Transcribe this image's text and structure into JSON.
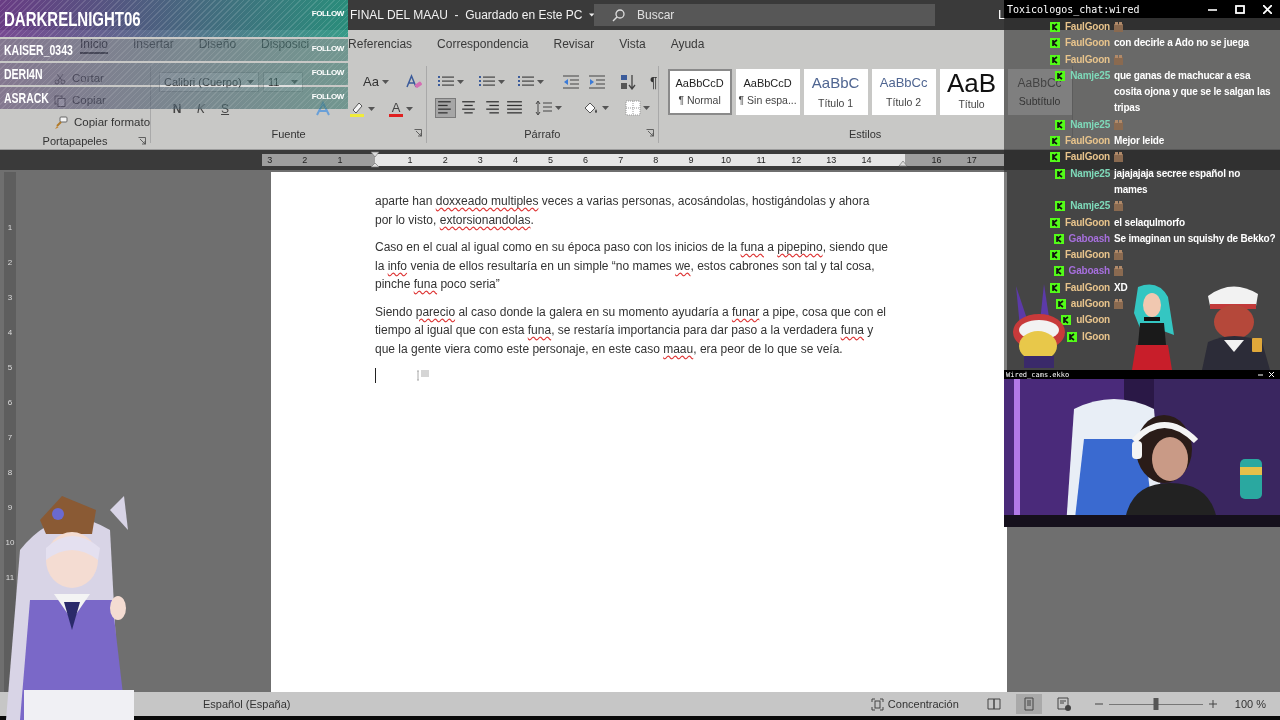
{
  "follow_overlay": {
    "rows": [
      {
        "name": "DARKRELNIGHT06",
        "action": "FOLLOW",
        "kind": "featured"
      },
      {
        "name": "KAISER_0343",
        "action": "FOLLOW",
        "kind": "normal"
      },
      {
        "name": "DERI4N",
        "action": "FOLLOW",
        "kind": "normal"
      },
      {
        "name": "ASRACK",
        "action": "FOLLOW",
        "kind": "normal"
      }
    ]
  },
  "title_bar": {
    "title": "FINAL DEL MAAU  -  Guardado en Este PC",
    "search": {
      "placeholder": "Buscar"
    },
    "user_initial": "L"
  },
  "ribbon_tabs": [
    {
      "label": "Inicio",
      "selected": true
    },
    {
      "label": "Insertar",
      "selected": false
    },
    {
      "label": "Diseño",
      "selected": false
    },
    {
      "label": "Disposici",
      "selected": false
    },
    {
      "label": "Referencias",
      "selected": false
    },
    {
      "label": "Correspondencia",
      "selected": false
    },
    {
      "label": "Revisar",
      "selected": false
    },
    {
      "label": "Vista",
      "selected": false
    },
    {
      "label": "Ayuda",
      "selected": false
    }
  ],
  "clipboard": {
    "label": "Portapapeles",
    "commands": [
      {
        "label": "Cortar",
        "kind": "cut"
      },
      {
        "label": "Copiar",
        "kind": "copy"
      },
      {
        "label": "Copiar formato",
        "kind": "format-painter"
      }
    ]
  },
  "font": {
    "label": "Fuente",
    "font_name": "Calibri (Cuerpo)",
    "font_size": "11",
    "change_case": "Aa",
    "font_color": "A",
    "format_buttons": [
      {
        "label": "N",
        "kind": "bold"
      },
      {
        "label": "K",
        "kind": "italic"
      },
      {
        "label": "S",
        "kind": "underline"
      }
    ]
  },
  "paragraph": {
    "label": "Párrafo",
    "show_marks": "¶",
    "align_buttons": [
      {
        "kind": "left",
        "selected": true
      },
      {
        "kind": "center",
        "selected": false
      },
      {
        "kind": "right",
        "selected": false
      },
      {
        "kind": "justify",
        "selected": false
      }
    ]
  },
  "styles": {
    "label": "Estilos",
    "items": [
      {
        "preview": "AaBbCcD",
        "name": "¶ Normal",
        "kind": "body",
        "selected": true
      },
      {
        "preview": "AaBbCcD",
        "name": "¶ Sin espa...",
        "kind": "body",
        "selected": false
      },
      {
        "preview": "AaBbC",
        "name": "Título 1",
        "kind": "heading1",
        "selected": false
      },
      {
        "preview": "AaBbCc",
        "name": "Título 2",
        "kind": "heading2",
        "selected": false
      },
      {
        "preview": "AaB",
        "name": "Título",
        "kind": "title",
        "selected": false
      },
      {
        "preview": "AaBbCc",
        "name": "Subtítulo",
        "kind": "subtitle",
        "selected": false
      }
    ]
  },
  "ruler": {
    "left_marks": [
      "3",
      "2",
      "1"
    ],
    "right_marks": [
      "1",
      "2",
      "3",
      "4",
      "5",
      "6",
      "7",
      "8",
      "9",
      "10",
      "11",
      "12",
      "13",
      "14",
      "16",
      "17"
    ],
    "vertical_marks": [
      "1",
      "2",
      "3",
      "4",
      "5",
      "6",
      "7",
      "8",
      "9",
      "10",
      "11"
    ]
  },
  "document": {
    "paragraphs": [
      {
        "lines": [
          [
            {
              "text": "aparte han ",
              "misspelled": false
            },
            {
              "text": "doxxeado multiples",
              "misspelled": true
            },
            {
              "text": " veces a varias personas, acosándolas, hostigándolas y ahora",
              "misspelled": false
            }
          ],
          [
            {
              "text": "por lo visto, ",
              "misspelled": false
            },
            {
              "text": "extorsionandolas",
              "misspelled": true
            },
            {
              "text": ".",
              "misspelled": false
            }
          ]
        ]
      },
      {
        "lines": [
          [
            {
              "text": "Caso en el cual al igual como en su época paso con los inicios de la ",
              "misspelled": false
            },
            {
              "text": "funa",
              "misspelled": true
            },
            {
              "text": " a ",
              "misspelled": false
            },
            {
              "text": "pipepino",
              "misspelled": true
            },
            {
              "text": ", siendo que",
              "misspelled": false
            }
          ],
          [
            {
              "text": "la ",
              "misspelled": false
            },
            {
              "text": "info",
              "misspelled": true
            },
            {
              "text": " venia de ellos resultaría en un simple “no mames ",
              "misspelled": false
            },
            {
              "text": "we",
              "misspelled": true
            },
            {
              "text": ", estos cabrones son tal y tal cosa,",
              "misspelled": false
            }
          ],
          [
            {
              "text": "pinche ",
              "misspelled": false
            },
            {
              "text": "funa",
              "misspelled": true
            },
            {
              "text": " poco seria”",
              "misspelled": false
            }
          ]
        ]
      },
      {
        "lines": [
          [
            {
              "text": "Siendo ",
              "misspelled": false
            },
            {
              "text": "parecio",
              "misspelled": true
            },
            {
              "text": " al caso donde la galera en su momento ayudaría a ",
              "misspelled": false
            },
            {
              "text": "funar",
              "misspelled": true
            },
            {
              "text": " a pipe, cosa que con el",
              "misspelled": false
            }
          ],
          [
            {
              "text": "tiempo al igual que con esta ",
              "misspelled": false
            },
            {
              "text": "funa",
              "misspelled": true
            },
            {
              "text": ", se restaría importancia para dar paso a la verdadera ",
              "misspelled": false
            },
            {
              "text": "funa",
              "misspelled": true
            },
            {
              "text": " y",
              "misspelled": false
            }
          ],
          [
            {
              "text": "que la gente viera como este personaje, en este caso ",
              "misspelled": false
            },
            {
              "text": "maau",
              "misspelled": true
            },
            {
              "text": ", era peor de lo que se veía.",
              "misspelled": false
            }
          ]
        ]
      }
    ]
  },
  "status_bar": {
    "language": "Español (España)",
    "focus": "Concentración",
    "views": [
      {
        "kind": "read",
        "selected": false
      },
      {
        "kind": "print",
        "selected": true
      },
      {
        "kind": "web",
        "selected": false
      }
    ],
    "zoom": {
      "level": 0.5,
      "reading": "100 %"
    }
  },
  "chat": {
    "title": "Toxicologos_chat:wired",
    "messages": [
      {
        "user": "FaulGoon",
        "color": "#e8c48c",
        "emote": true
      },
      {
        "user": "FaulGoon",
        "color": "#e8c48c",
        "text": "con decirle a Ado no se juega",
        "emote": false
      },
      {
        "user": "FaulGoon",
        "color": "#e8c48c",
        "emote": true
      },
      {
        "user": "Namje25",
        "color": "#7ed9b9",
        "text": "que ganas de machucar a esa cosita ojona y que se le salgan las tripas",
        "emote": false
      },
      {
        "user": "Namje25",
        "color": "#7ed9b9",
        "emote": true
      },
      {
        "user": "FaulGoon",
        "color": "#e8c48c",
        "text": "Mejor leide",
        "emote": false
      },
      {
        "user": "FaulGoon",
        "color": "#e8c48c",
        "emote": true
      },
      {
        "user": "Namje25",
        "color": "#7ed9b9",
        "text": "jajajajaja secree español no mames",
        "emote": false
      },
      {
        "user": "Namje25",
        "color": "#7ed9b9",
        "emote": true
      },
      {
        "user": "FaulGoon",
        "color": "#e8c48c",
        "text": "el selaqulmorfo",
        "emote": false
      },
      {
        "user": "Gaboash",
        "color": "#a66fdc",
        "text": "Se imaginan un squishy de Bekko?",
        "emote": false
      },
      {
        "user": "FaulGoon",
        "color": "#e8c48c",
        "emote": true
      },
      {
        "user": "Gaboash",
        "color": "#a66fdc",
        "emote": true
      },
      {
        "user": "FaulGoon",
        "color": "#e8c48c",
        "text": "XD",
        "emote": false
      },
      {
        "user": "aulGoon",
        "color": "#e8c48c",
        "emote": true
      },
      {
        "user": "ulGoon",
        "color": "#e8c48c",
        "emote": false
      },
      {
        "user": "lGoon",
        "color": "#e8c48c",
        "emote": false
      }
    ]
  },
  "webcam": {
    "title": "Wired_cams.ekko"
  }
}
